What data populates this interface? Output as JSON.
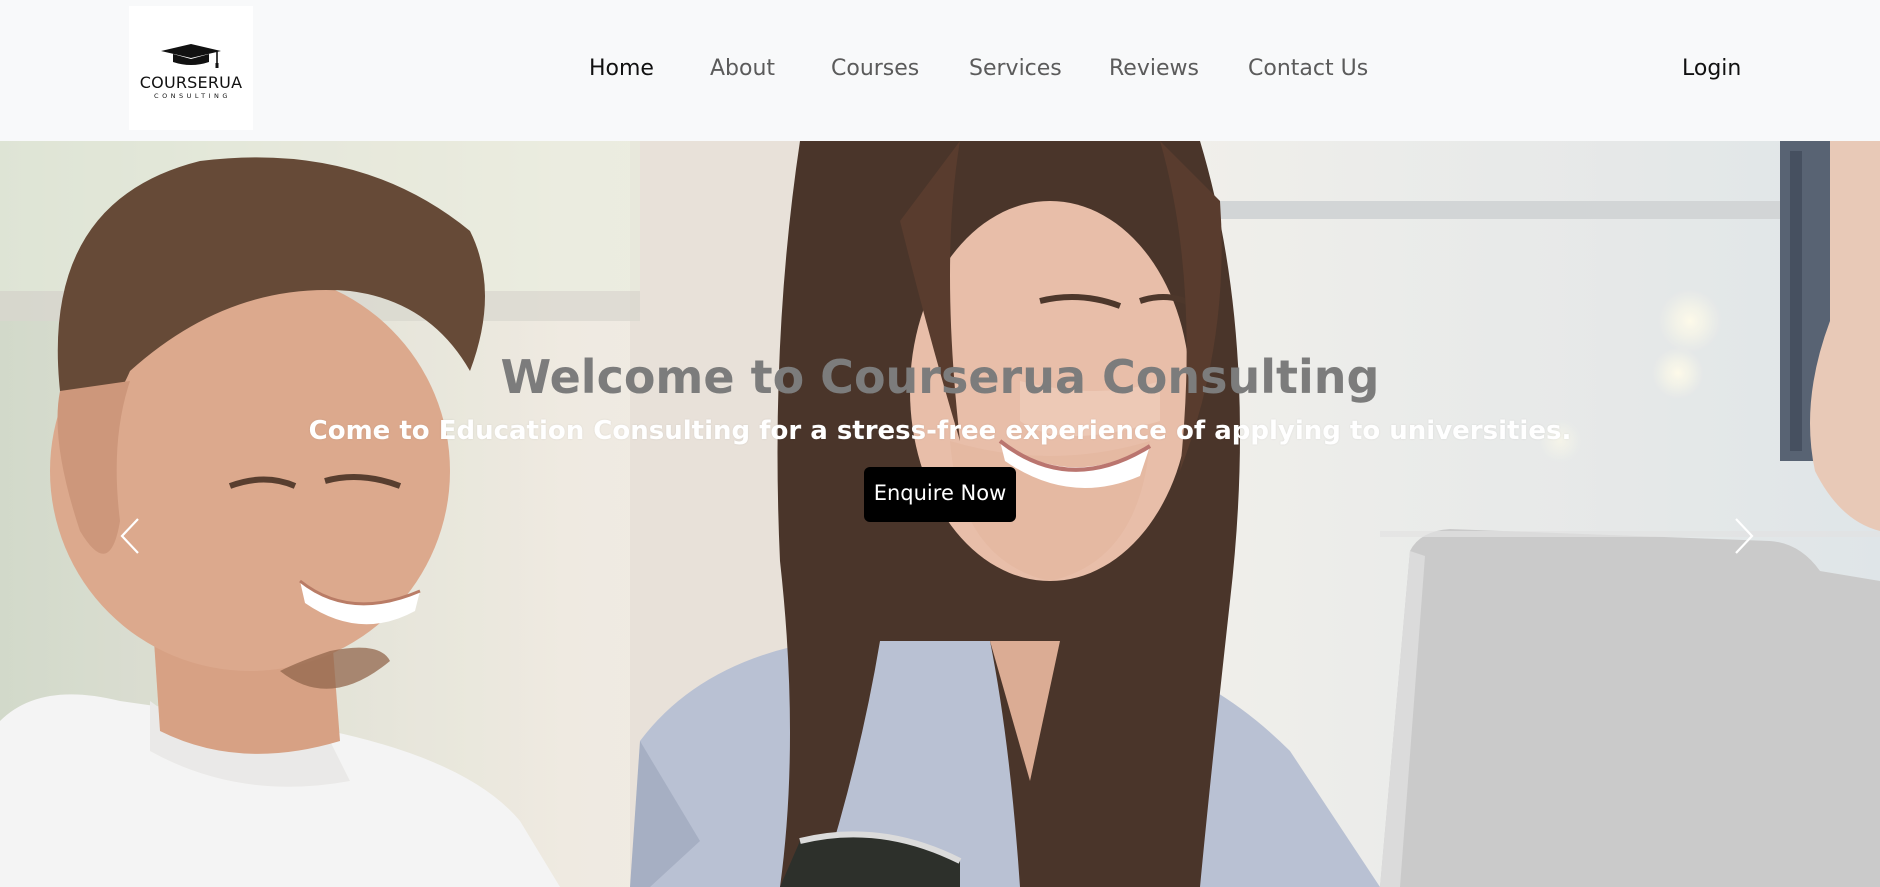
{
  "brand": {
    "name": "COURSERUA",
    "tagline": "CONSULTING",
    "logo_icon": "graduation-cap-icon"
  },
  "nav": {
    "items": [
      {
        "label": "Home",
        "active": true
      },
      {
        "label": "About",
        "active": false
      },
      {
        "label": "Courses",
        "active": false
      },
      {
        "label": "Services",
        "active": false
      },
      {
        "label": "Reviews",
        "active": false
      },
      {
        "label": "Contact Us",
        "active": false
      }
    ],
    "login_label": "Login"
  },
  "hero": {
    "title": "Welcome to Courserua Consulting",
    "subtitle": "Come to Education Consulting for a stress-free experience of applying to universities.",
    "cta_label": "Enquire Now",
    "prev_icon": "chevron-left-icon",
    "next_icon": "chevron-right-icon"
  },
  "colors": {
    "navbar_bg": "#f8f9fa",
    "nav_active": "#111111",
    "nav_inactive": "#5b5b5b",
    "title_gray": "#7c7c7c",
    "cta_bg": "#000000",
    "cta_text": "#ffffff"
  }
}
